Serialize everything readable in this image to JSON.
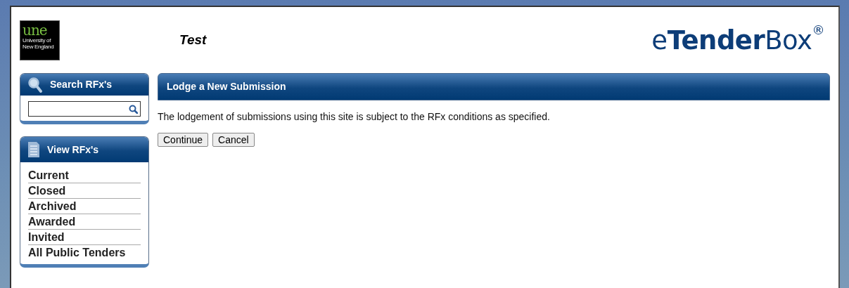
{
  "header": {
    "logo": {
      "mark": "une",
      "name_lines": [
        "University of",
        "New England"
      ]
    },
    "site_title": "Test",
    "brand": "e**Tender**Box$^{®}$"
  },
  "search_panel": {
    "title": "Search RFx's"
  },
  "view_panel": {
    "title": "View RFx's",
    "items": [
      {
        "label": "Current"
      },
      {
        "label": "Closed"
      },
      {
        "label": "Archived"
      },
      {
        "label": "Awarded"
      },
      {
        "label": "Invited"
      },
      {
        "label": "All Public Tenders"
      }
    ]
  },
  "main": {
    "title": "Lodge a New Submission",
    "message": "The lodgement of submissions using this site is subject to the RFx conditions as specified.",
    "buttons": [
      "Continue",
      "Cancel"
    ]
  }
}
